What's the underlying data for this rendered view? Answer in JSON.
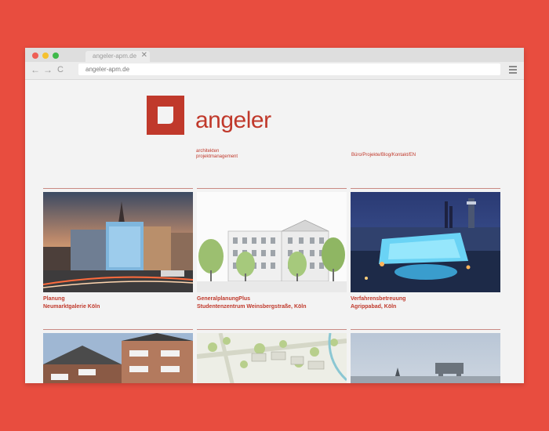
{
  "browser": {
    "tab_title": "angeler-apm.de",
    "tab_close": "✕",
    "url": "angeler-apm.de",
    "back": "←",
    "forward": "→",
    "reload": "C"
  },
  "site": {
    "brand": "angeler",
    "tagline_line1": "architekten",
    "tagline_line2": "projektmanagement",
    "nav": "Büro/Projekte/Blog/Kontakt/EN",
    "accent": "#c0392b"
  },
  "projects": [
    {
      "line1": "Planung",
      "line2": "Neumarktgalerie Köln"
    },
    {
      "line1": "GeneralplanungPlus",
      "line2": "Studentenzentrum Weinsbergstraße, Köln"
    },
    {
      "line1": "Verfahrensbetreuung",
      "line2": "Agrippabad, Köln"
    }
  ]
}
